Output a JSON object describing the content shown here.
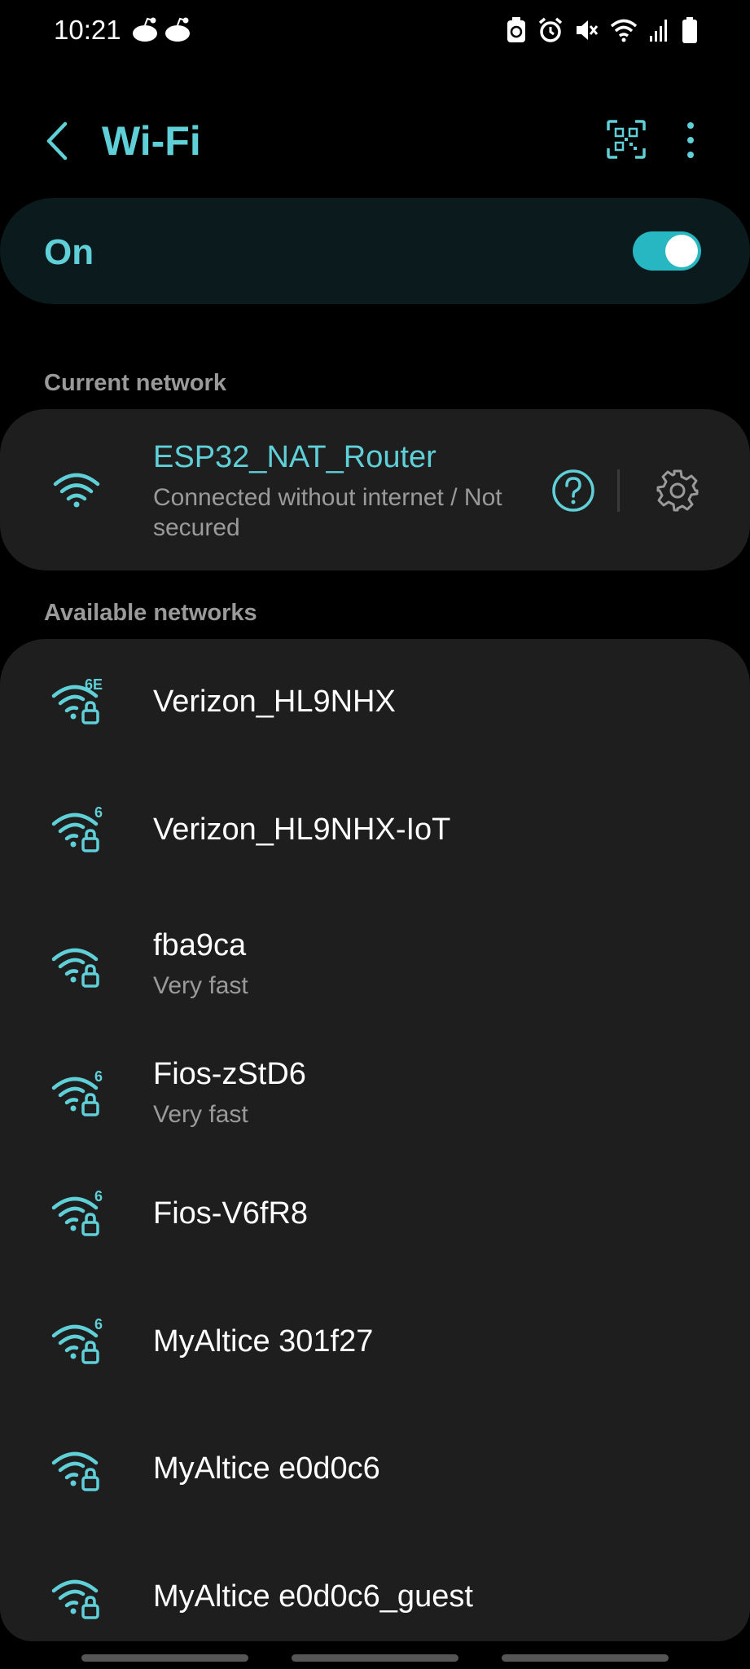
{
  "status_bar": {
    "time": "10:21",
    "notification_icons": [
      "reddit-icon",
      "reddit-icon"
    ],
    "system_icons": [
      "battery-saver-icon",
      "alarm-icon",
      "mute-icon",
      "wifi-icon",
      "signal-icon",
      "battery-icon"
    ]
  },
  "header": {
    "title": "Wi-Fi",
    "back_icon": "chevron-left-icon",
    "qr_icon": "qr-code-icon",
    "more_icon": "more-vert-icon"
  },
  "wifi_toggle": {
    "label": "On",
    "state": "on"
  },
  "current_network": {
    "section_label": "Current network",
    "name": "ESP32_NAT_Router",
    "status": "Connected without internet / Not secured"
  },
  "available": {
    "section_label": "Available networks",
    "networks": [
      {
        "name": "Verizon_HL9NHX",
        "badge": "6E",
        "subtitle": ""
      },
      {
        "name": "Verizon_HL9NHX-IoT",
        "badge": "6",
        "subtitle": ""
      },
      {
        "name": "fba9ca",
        "badge": "",
        "subtitle": "Very fast"
      },
      {
        "name": "Fios-zStD6",
        "badge": "6",
        "subtitle": "Very fast"
      },
      {
        "name": "Fios-V6fR8",
        "badge": "6",
        "subtitle": ""
      },
      {
        "name": "MyAltice 301f27",
        "badge": "6",
        "subtitle": ""
      },
      {
        "name": "MyAltice e0d0c6",
        "badge": "",
        "subtitle": ""
      },
      {
        "name": "MyAltice e0d0c6_guest",
        "badge": "",
        "subtitle": ""
      }
    ]
  },
  "colors": {
    "accent": "#5fd0d8",
    "toggle": "#26b7c2",
    "card": "#1e1e1e",
    "toggle_card": "#0b1a1c",
    "secondary_text": "#9a9a9a",
    "background": "#000000"
  }
}
